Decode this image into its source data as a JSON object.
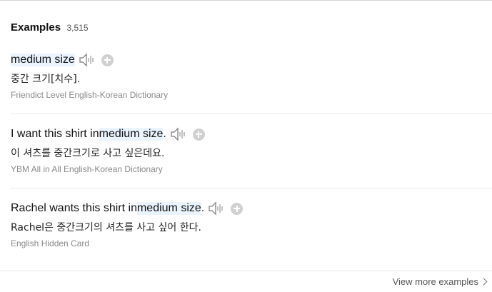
{
  "header": {
    "title": "Examples",
    "count": "3,515"
  },
  "examples": [
    {
      "en_pre": "",
      "en_highlight": "medium size",
      "en_post": "",
      "ko": "중간 크기[치수].",
      "source": "Friendict Level English-Korean Dictionary"
    },
    {
      "en_pre": "I want this shirt in ",
      "en_highlight": "medium size",
      "en_post": ".",
      "ko": "이 셔츠를 중간크기로 사고 싶은데요.",
      "source": "YBM All in All English-Korean Dictionary"
    },
    {
      "en_pre": "Rachel wants this shirt in ",
      "en_highlight": "medium size",
      "en_post": ".",
      "ko": "Rachel은 중간크기의 셔츠를 사고 싶어 한다.",
      "source": "English Hidden Card"
    }
  ],
  "footer": {
    "view_more": "View more examples"
  },
  "icons": {
    "speaker": "speaker-icon",
    "add": "add-icon",
    "chevron": "chevron-right-icon"
  }
}
